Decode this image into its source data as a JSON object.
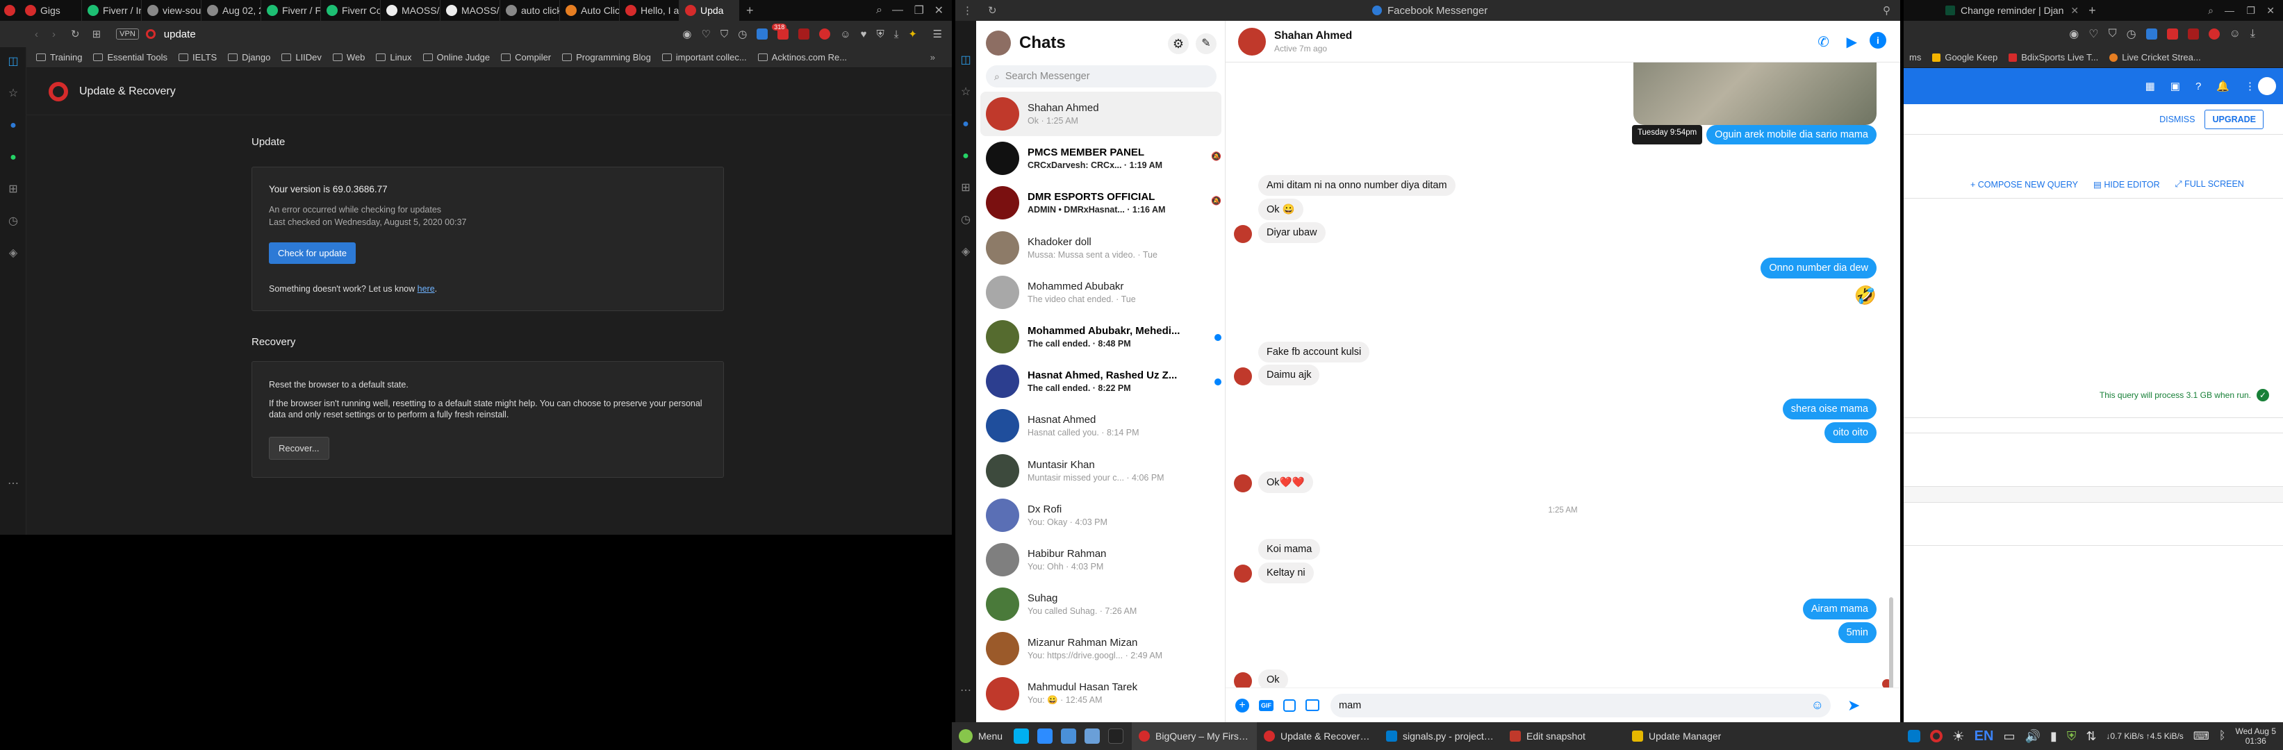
{
  "opera": {
    "tabs": [
      {
        "label": "Gigs",
        "color": "#d52b2b"
      },
      {
        "label": "Fiverr / In",
        "color": "#1dbf73"
      },
      {
        "label": "view-sou",
        "color": "#888"
      },
      {
        "label": "Aug 02, 2",
        "color": "#888"
      },
      {
        "label": "Fiverr / Fi",
        "color": "#1dbf73"
      },
      {
        "label": "Fiverr Co",
        "color": "#1dbf73"
      },
      {
        "label": "MAOSS/A",
        "color": "#eee"
      },
      {
        "label": "MAOSS/n",
        "color": "#eee"
      },
      {
        "label": "auto click",
        "color": "#888"
      },
      {
        "label": "Auto Clic",
        "color": "#e67e22"
      },
      {
        "label": "Hello, I a",
        "color": "#d52b2b"
      },
      {
        "label": "Upda",
        "color": "#d52b2b",
        "active": true
      }
    ],
    "url": "update",
    "vpn_label": "VPN",
    "badge_count": "318",
    "bookmarks": [
      "Training",
      "Essential Tools",
      "IELTS",
      "Django",
      "LIIDev",
      "Web",
      "Linux",
      "Online Judge",
      "Compiler",
      "Programming Blog",
      "important collec...",
      "Acktinos.com Re..."
    ],
    "page_title": "Update & Recovery",
    "update": {
      "heading": "Update",
      "version_label": "Your version is",
      "version": "69.0.3686.77",
      "error": "An error occurred while checking for updates",
      "last_checked": "Last checked on Wednesday, August 5, 2020 00:37",
      "check_button": "Check for update",
      "help_text": "Something doesn't work? Let us know",
      "help_link": "here",
      "help_end": "."
    },
    "recovery": {
      "heading": "Recovery",
      "line1": "Reset the browser to a default state.",
      "line2": "If the browser isn't running well, resetting to a default state might help. You can choose to preserve your personal data and only reset settings or to perform a fully fresh reinstall.",
      "button": "Recover..."
    }
  },
  "messenger": {
    "window_title": "Facebook Messenger",
    "chats_title": "Chats",
    "search_placeholder": "Search Messenger",
    "chats": [
      {
        "name": "Shahan Ahmed",
        "sub": "Ok · 1:25 AM",
        "bold": false,
        "selected": true,
        "color": "#c0392b"
      },
      {
        "name": "PMCS MEMBER PANEL",
        "sub": "CRCxDarvesh: CRCx... · 1:19 AM",
        "bold": true,
        "color": "#111"
      },
      {
        "name": "DMR ESPORTS OFFICIAL",
        "sub": "ADMIN • DMRxHasnat... · 1:16 AM",
        "bold": true,
        "color": "#7a1010"
      },
      {
        "name": "Khadoker doll",
        "sub": "Mussa: Mussa sent a video. · Tue",
        "bold": false,
        "color": "#8d7b68"
      },
      {
        "name": "Mohammed Abubakr",
        "sub": "The video chat ended. · Tue",
        "bold": false,
        "color": "#a8a8a8"
      },
      {
        "name": "Mohammed Abubakr, Mehedi...",
        "sub": "The call ended. · 8:48 PM",
        "bold": true,
        "color": "#556b2f"
      },
      {
        "name": "Hasnat Ahmed, Rashed Uz Z...",
        "sub": "The call ended. · 8:22 PM",
        "bold": true,
        "color": "#2c3e8f"
      },
      {
        "name": "Hasnat Ahmed",
        "sub": "Hasnat called you. · 8:14 PM",
        "bold": false,
        "color": "#1f4e9c"
      },
      {
        "name": "Muntasir Khan",
        "sub": "Muntasir missed your c... · 4:06 PM",
        "bold": false,
        "color": "#3d4a3d"
      },
      {
        "name": "Dx Rofi",
        "sub": "You: Okay · 4:03 PM",
        "bold": false,
        "color": "#5a6fb5"
      },
      {
        "name": "Habibur Rahman",
        "sub": "You: Ohh · 4:03 PM",
        "bold": false,
        "color": "#7f7f7f"
      },
      {
        "name": "Suhag",
        "sub": "You called Suhag. · 7:26 AM",
        "bold": false,
        "color": "#4a7a3a"
      },
      {
        "name": "Mizanur Rahman Mizan",
        "sub": "You: https://drive.googl... · 2:49 AM",
        "bold": false,
        "color": "#9b5a2a"
      },
      {
        "name": "Mahmudul Hasan Tarek",
        "sub": "You: 😀 · 12:45 AM",
        "bold": false,
        "color": "#c0392b"
      }
    ],
    "conversation": {
      "name": "Shahan Ahmed",
      "status": "Active 7m ago",
      "tooltip": "Tuesday 9:54pm",
      "messages": [
        {
          "text": "Oguin arek mobile dia sario mama",
          "side": "out"
        },
        {
          "text": "Ami ditam ni na onno number diya ditam",
          "side": "in"
        },
        {
          "text": "Ok 😀",
          "side": "in"
        },
        {
          "text": "Diyar ubaw",
          "side": "in"
        },
        {
          "text": "Onno number dia dew",
          "side": "out"
        },
        {
          "text": "🤣",
          "side": "out"
        },
        {
          "text": "Fake fb account kulsi",
          "side": "in"
        },
        {
          "text": "Daimu ajk",
          "side": "in"
        },
        {
          "text": "shera oise mama",
          "side": "out"
        },
        {
          "text": "oito oito",
          "side": "out"
        },
        {
          "text": "Ok❤️❤️",
          "side": "in"
        },
        {
          "text": "1:25 AM",
          "side": "time"
        },
        {
          "text": "Koi mama",
          "side": "in"
        },
        {
          "text": "Keltay ni",
          "side": "in"
        },
        {
          "text": "Airam mama",
          "side": "out"
        },
        {
          "text": "5min",
          "side": "out"
        },
        {
          "text": "Ok",
          "side": "in"
        }
      ],
      "composer_value": "mam"
    }
  },
  "bigquery": {
    "tab_title": "Change reminder | Djan",
    "bookmarks": [
      "ms",
      "Google Keep",
      "BdixSports Live T...",
      "Live Cricket Strea..."
    ],
    "dismiss": "DISMISS",
    "upgrade": "UPGRADE",
    "compose": "COMPOSE NEW QUERY",
    "hide_editor": "HIDE EDITOR",
    "full_screen": "FULL SCREEN",
    "query_info": "This query will process 3.1 GB when run."
  },
  "taskbar": {
    "menu": "Menu",
    "items": [
      {
        "label": "BigQuery – My First Pr...",
        "active": true
      },
      {
        "label": "Update & Recovery - O...",
        "active": false
      },
      {
        "label": "signals.py - project - Vi...",
        "active": false
      },
      {
        "label": "Edit snapshot",
        "active": false
      },
      {
        "label": "Update Manager",
        "active": false
      }
    ],
    "lang": "EN",
    "net_speed": "↓0.7 KiB/s ↑4.5 KiB/s",
    "date": "Wed Aug 5",
    "time": "01:36"
  }
}
